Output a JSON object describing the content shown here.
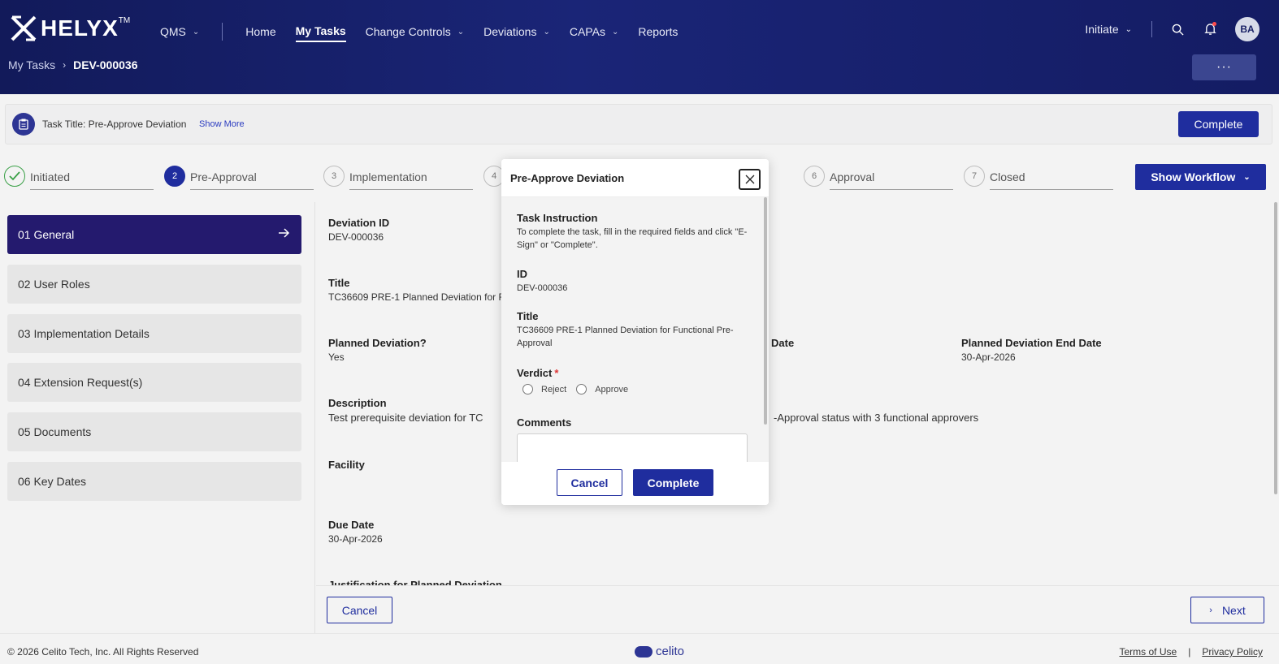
{
  "colors": {
    "header_bg": "#1a2577",
    "primary": "#1f2d9e",
    "sidebar_active": "#241a6e",
    "step_done": "#3aa047",
    "notification": "#ff4b4b"
  },
  "header": {
    "logo": "HELYX",
    "logo_tm": "TM",
    "nav": {
      "qms": "QMS",
      "home": "Home",
      "my_tasks": "My Tasks",
      "change_controls": "Change Controls",
      "deviations": "Deviations",
      "capas": "CAPAs",
      "reports": "Reports"
    },
    "initiate": "Initiate",
    "avatar": "BA",
    "more_label": "···"
  },
  "breadcrumb": {
    "parent": "My Tasks",
    "current": "DEV-000036"
  },
  "task": {
    "title": "Task Title: Pre-Approve Deviation",
    "show_more": "Show More",
    "complete": "Complete"
  },
  "steps": [
    {
      "num": "",
      "label": "Initiated",
      "state": "done"
    },
    {
      "num": "2",
      "label": "Pre-Approval",
      "state": "current"
    },
    {
      "num": "3",
      "label": "Implementation",
      "state": "pending"
    },
    {
      "num": "4",
      "label": "",
      "state": "pending"
    },
    {
      "num": "6",
      "label": "Approval",
      "state": "pending"
    },
    {
      "num": "7",
      "label": "Closed",
      "state": "pending"
    }
  ],
  "show_workflow": "Show Workflow",
  "sidebar": {
    "items": [
      {
        "label": "01 General"
      },
      {
        "label": "02 User Roles"
      },
      {
        "label": "03 Implementation Details"
      },
      {
        "label": "04 Extension Request(s)"
      },
      {
        "label": "05 Documents"
      },
      {
        "label": "06 Key Dates"
      }
    ]
  },
  "main": {
    "deviation_id_label": "Deviation ID",
    "deviation_id": "DEV-000036",
    "title_label": "Title",
    "title_value": "TC36609 PRE-1 Planned Deviation for F",
    "planned_label": "Planned Deviation?",
    "planned_value": "Yes",
    "start_date_label_tail": "Date",
    "end_date_label": "Planned Deviation End Date",
    "end_date_value": "30-Apr-2026",
    "description_label": "Description",
    "description_start": "Test prerequisite deviation for TC",
    "description_end": "-Approval status with 3 functional approvers",
    "facility_label": "Facility",
    "due_date_label": "Due Date",
    "due_date_value": "30-Apr-2026",
    "justification_label": "Justification for Planned Deviation"
  },
  "bottom": {
    "cancel": "Cancel",
    "next": "Next"
  },
  "footer": {
    "copyright": "© 2026 Celito Tech, Inc. All Rights Reserved",
    "brand": "celito",
    "terms": "Terms of Use",
    "separator": "|",
    "privacy": "Privacy Policy"
  },
  "modal": {
    "title": "Pre-Approve Deviation",
    "instruction_label": "Task Instruction",
    "instruction_text": "To complete the task, fill in the required fields and click \"E-Sign\" or \"Complete\".",
    "id_label": "ID",
    "id_value": "DEV-000036",
    "title_label": "Title",
    "title_value": "TC36609 PRE-1 Planned Deviation for Functional Pre-Approval",
    "verdict_label": "Verdict",
    "required_mark": "*",
    "reject": "Reject",
    "approve": "Approve",
    "comments_label": "Comments",
    "cancel": "Cancel",
    "complete": "Complete"
  }
}
